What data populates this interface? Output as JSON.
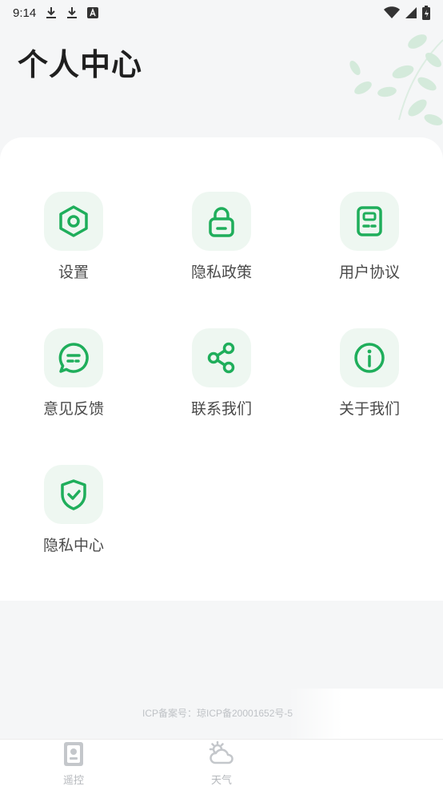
{
  "status_bar": {
    "time": "9:14",
    "left_icons": [
      "download-icon",
      "download-icon",
      "notification-a-icon"
    ],
    "right_icons": [
      "wifi-icon",
      "signal-icon",
      "battery-icon"
    ]
  },
  "header": {
    "title": "个人中心"
  },
  "menu": {
    "items": [
      {
        "label": "设置",
        "icon": "settings-hexagon-icon"
      },
      {
        "label": "隐私政策",
        "icon": "lock-icon"
      },
      {
        "label": "用户协议",
        "icon": "document-icon"
      },
      {
        "label": "意见反馈",
        "icon": "chat-bubble-icon"
      },
      {
        "label": "联系我们",
        "icon": "share-icon"
      },
      {
        "label": "关于我们",
        "icon": "info-icon"
      },
      {
        "label": "隐私中心",
        "icon": "shield-check-icon"
      }
    ]
  },
  "footer": {
    "icp": "ICP备案号：琼ICP备20001652号-5"
  },
  "tabs": [
    {
      "label": "遥控",
      "icon": "remote-icon"
    },
    {
      "label": "天气",
      "icon": "weather-icon"
    }
  ],
  "colors": {
    "accent": "#1fae5b",
    "icon_bg": "#eef7f1",
    "page_bg": "#f5f6f7"
  }
}
